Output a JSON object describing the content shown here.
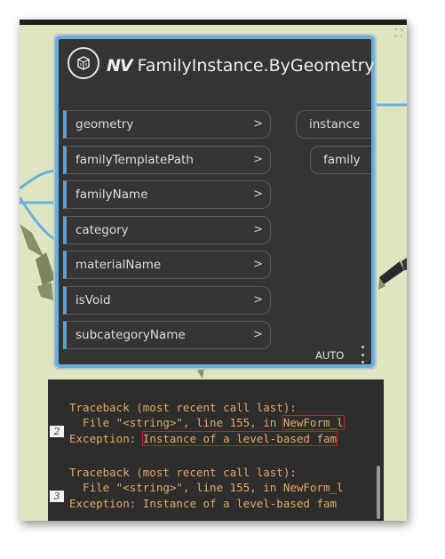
{
  "node": {
    "title_glyph": "NV",
    "title": "FamilyInstance.ByGeometry",
    "inputs": [
      {
        "label": "geometry",
        "arrow": ">"
      },
      {
        "label": "familyTemplatePath",
        "arrow": ">"
      },
      {
        "label": "familyName",
        "arrow": ">"
      },
      {
        "label": "category",
        "arrow": ">"
      },
      {
        "label": "materialName",
        "arrow": ">"
      },
      {
        "label": "isVoid",
        "arrow": ">"
      },
      {
        "label": "subcategoryName",
        "arrow": ">"
      }
    ],
    "outputs": [
      {
        "label": "instance"
      },
      {
        "label": "family"
      }
    ],
    "lacing": "AUTO"
  },
  "console": {
    "entries": [
      {
        "number": "2",
        "traceback": "Traceback (most recent call last):",
        "file_prefix": "  File \"<string>\", line 155, in ",
        "file_highlight": "NewForm_l",
        "exception_prefix": "Exception: ",
        "exception_highlight": "Instance of a level-based fam"
      },
      {
        "number": "3",
        "traceback": "Traceback (most recent call last):",
        "file_prefix": "  File \"<string>\", line 155, in ",
        "file_highlight": "NewForm_l",
        "exception_prefix": "Exception: ",
        "exception_highlight": "Instance of a level-based fam"
      }
    ]
  },
  "colors": {
    "canvas": "#dde6c0",
    "node_body": "#343434",
    "node_border": "#6aaee0",
    "console_bg": "#2d2d2d",
    "console_text": "#e6a862",
    "highlight": "#d02020"
  }
}
